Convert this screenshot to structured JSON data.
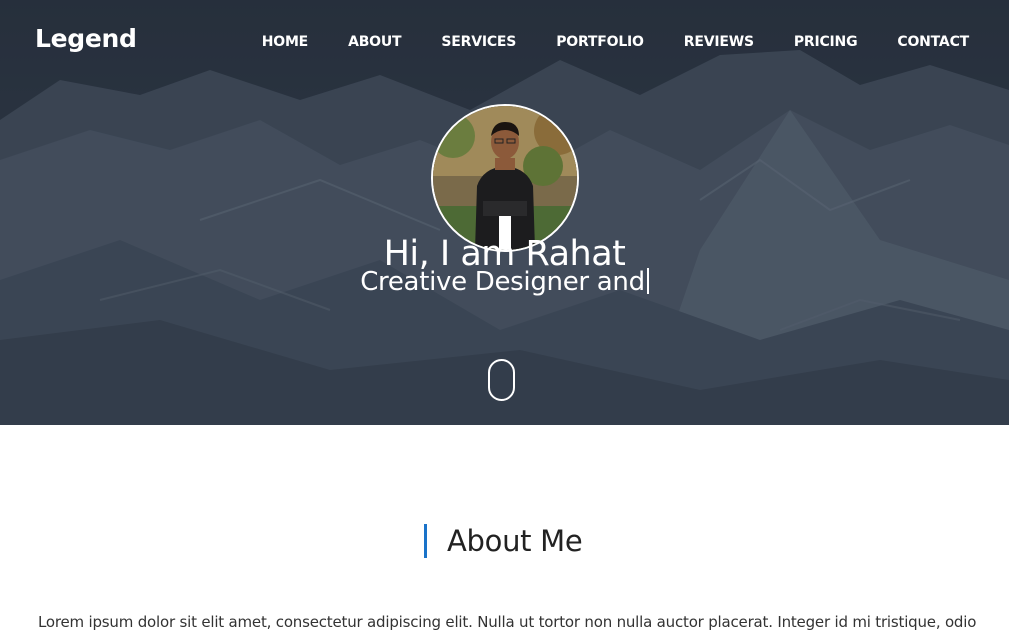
{
  "brand": "Legend",
  "nav": {
    "items": [
      {
        "label": "HOME"
      },
      {
        "label": "ABOUT"
      },
      {
        "label": "SERVICES"
      },
      {
        "label": "PORTFOLIO"
      },
      {
        "label": "REVIEWS"
      },
      {
        "label": "PRICING"
      },
      {
        "label": "CONTACT"
      }
    ]
  },
  "hero": {
    "title": "Hi, I am Rahat",
    "subtitle": "Creative Designer and"
  },
  "about": {
    "title": "About Me",
    "text": "Lorem ipsum dolor sit elit amet, consectetur adipiscing elit. Nulla ut tortor non nulla auctor placerat. Integer id mi tristique, odio"
  },
  "colors": {
    "accent": "#1a73c9",
    "hero_overlay": "#2f3947",
    "text_dark": "#222222"
  },
  "icons": {
    "scroll": "mouse-scroll-icon"
  }
}
